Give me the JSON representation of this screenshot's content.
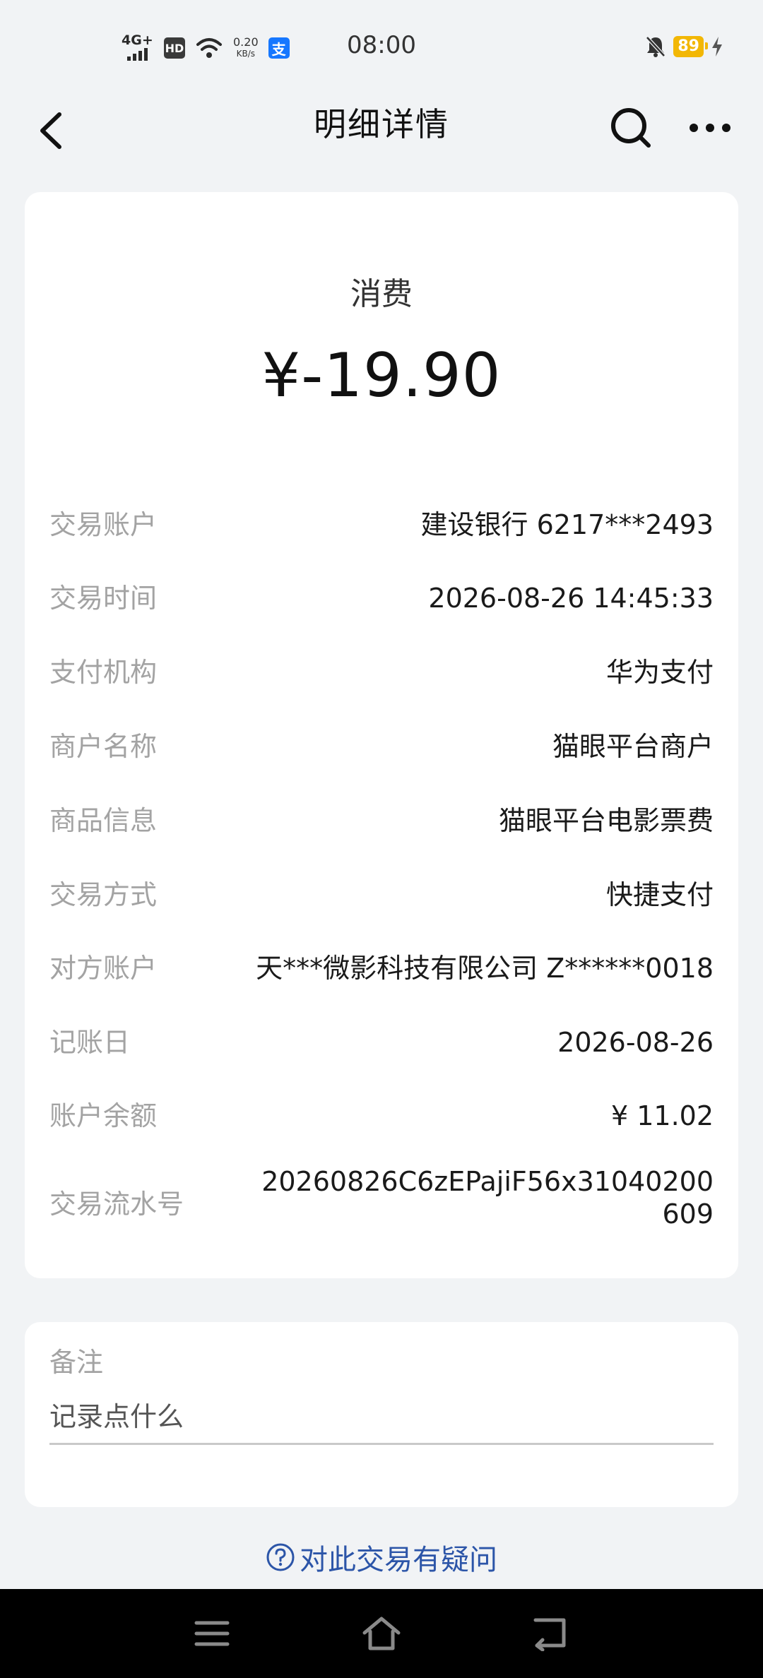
{
  "status_bar": {
    "network": "4G+",
    "hd": "HD",
    "speed_value": "0.20",
    "speed_unit": "KB/s",
    "pay_icon_glyph": "支",
    "time": "08:00",
    "battery": "89"
  },
  "header": {
    "title": "明细详情"
  },
  "transaction": {
    "type": "消费",
    "amount": "¥-19.90",
    "rows": [
      {
        "label": "交易账户",
        "value": "建设银行 6217***2493"
      },
      {
        "label": "交易时间",
        "value": "2026-08-26 14:45:33"
      },
      {
        "label": "支付机构",
        "value": "华为支付"
      },
      {
        "label": "商户名称",
        "value": "猫眼平台商户"
      },
      {
        "label": "商品信息",
        "value": "猫眼平台电影票费"
      },
      {
        "label": "交易方式",
        "value": "快捷支付"
      },
      {
        "label": "对方账户",
        "value": "天***微影科技有限公司 Z******0018"
      },
      {
        "label": "记账日",
        "value": "2026-08-26"
      },
      {
        "label": "账户余额",
        "value": "¥ 11.02"
      },
      {
        "label": "交易流水号",
        "value": "20260826C6zEPajiF56x31040200609"
      }
    ]
  },
  "note": {
    "title": "备注",
    "placeholder": "记录点什么"
  },
  "question_link": "对此交易有疑问",
  "colors": {
    "background": "#f1f3f5",
    "link": "#2c55a8",
    "battery": "#f2b705",
    "pay_badge": "#1677ff"
  }
}
